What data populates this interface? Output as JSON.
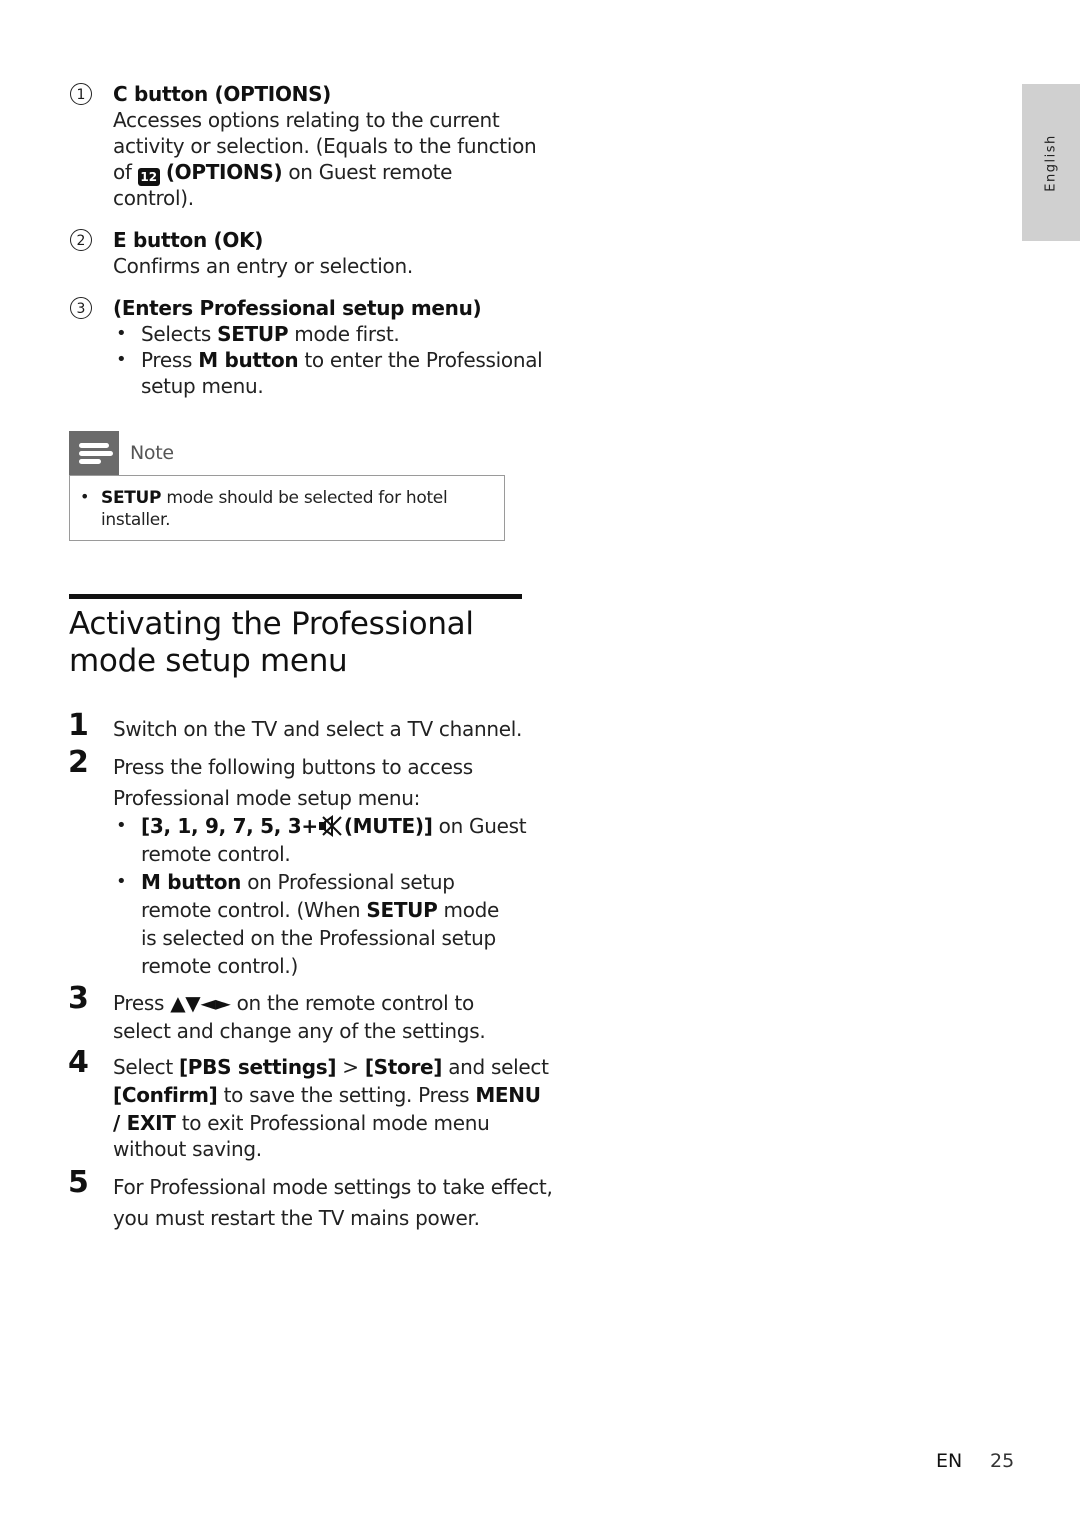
{
  "side_tab": {
    "label": "English"
  },
  "callouts": [
    {
      "number": "1",
      "title": "C button (OPTIONS)",
      "lines": [
        "Accesses options relating to the current",
        "activity or selection. (Equals to the function"
      ],
      "line3_prefix": "of",
      "options_icon_text": "12",
      "line3_bold": "(OPTIONS)",
      "line3_suffix": "on Guest remote",
      "line4": "control)."
    },
    {
      "number": "2",
      "title": "E button (OK)",
      "desc": "Confirms an entry or selection."
    },
    {
      "number": "3",
      "title": "(Enters Professional setup menu)",
      "bullet1_pre": "Selects",
      "bullet1_bold": "SETUP",
      "bullet1_post": "mode first.",
      "bullet2_pre": "Press",
      "bullet2_bold": "M button",
      "bullet2_post": "to enter the Professional",
      "bullet2_line2": "setup menu."
    }
  ],
  "note": {
    "label": "Note",
    "bold": "SETUP",
    "text": "mode should be selected for hotel",
    "text_line2": "installer."
  },
  "section": {
    "title_line1": "Activating the Professional",
    "title_line2": "mode setup menu"
  },
  "steps": {
    "s1": {
      "num": "1",
      "text": "Switch on the TV and select a TV channel."
    },
    "s2": {
      "num": "2",
      "line1": "Press the following buttons to access",
      "line2": "Professional mode setup menu:",
      "b1_bold_pre": "[3, 1, 9, 7, 5, 3+",
      "b1_bold_post": "(MUTE)]",
      "b1_post": "on Guest",
      "b1_line2": "remote control.",
      "b2_bold": "M button",
      "b2_post": "on Professional setup",
      "b2_line2_pre": "remote control. (When",
      "b2_line2_bold": "SETUP",
      "b2_line2_post": "mode",
      "b2_line3": "is selected on the Professional setup",
      "b2_line4": "remote control.)"
    },
    "s3": {
      "num": "3",
      "pre": "Press",
      "arrows": "▲▼◄►",
      "post": "on the remote control to",
      "line2": "select and change any of the settings."
    },
    "s4": {
      "num": "4",
      "pre": "Select",
      "bold1": "[PBS settings]",
      "sep": ">",
      "bold2": "[Store]",
      "post": "and select",
      "l2_bold": "[Confirm]",
      "l2_post": "to save the setting. Press",
      "l2_bold2": "MENU",
      "l3_bold": "/ EXIT",
      "l3_post": "to exit Professional mode menu",
      "l4": "without saving."
    },
    "s5": {
      "num": "5",
      "line1": "For Professional mode settings to take effect,",
      "line2": "you must restart the TV mains power."
    }
  },
  "footer": {
    "lang": "EN",
    "page": "25"
  }
}
